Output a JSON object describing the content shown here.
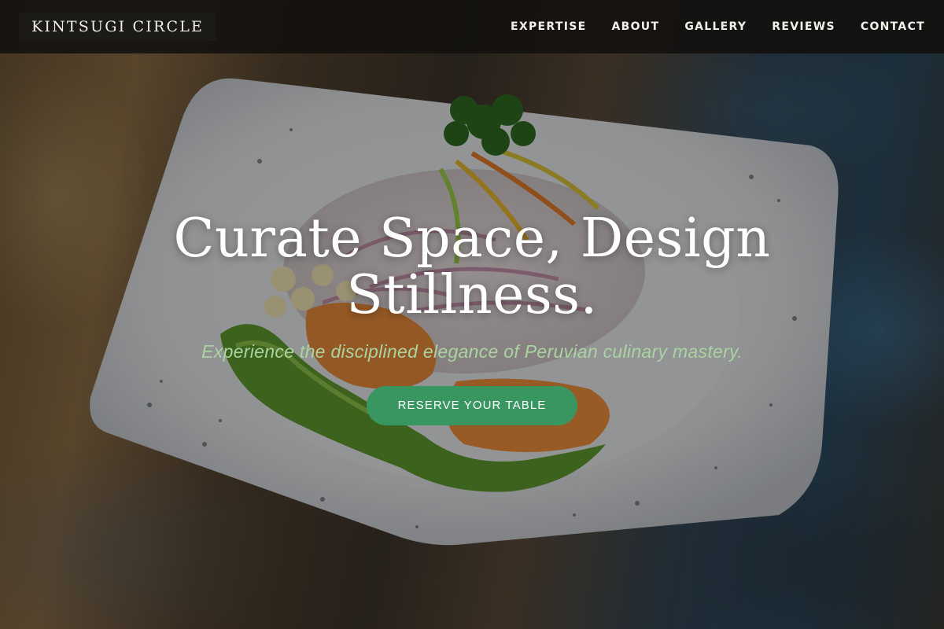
{
  "nav": {
    "brand": "KINTSUGI CIRCLE",
    "links": [
      "EXPERTISE",
      "ABOUT",
      "GALLERY",
      "REVIEWS",
      "CONTACT"
    ]
  },
  "hero": {
    "title": "Curate Space, Design Stillness.",
    "subtitle": "Experience the disciplined elegance of Peruvian culinary mastery.",
    "cta_label": "RESERVE YOUR TABLE"
  },
  "colors": {
    "accent": "#3a9660",
    "subtitle": "#a9d3a0",
    "navbar": "#12100e"
  }
}
